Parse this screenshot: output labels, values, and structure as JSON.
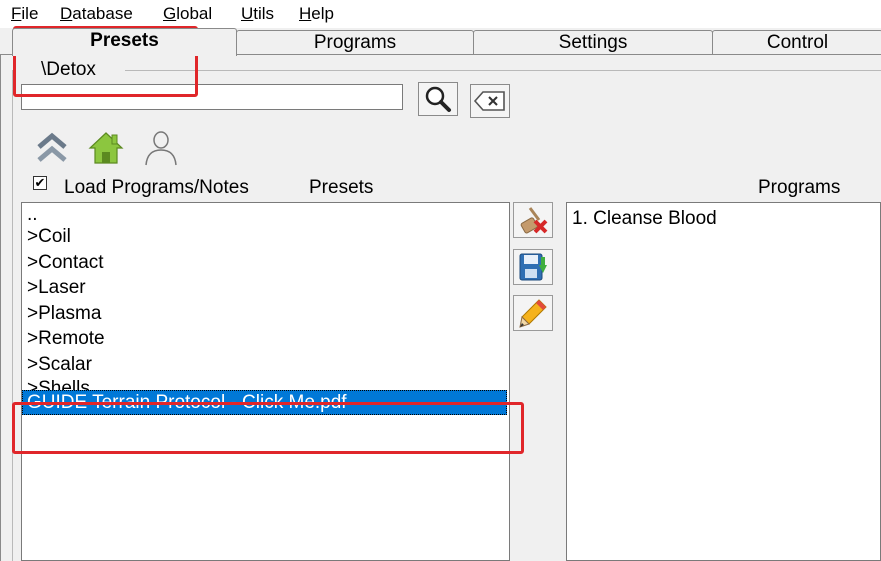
{
  "menu": {
    "items": [
      {
        "mnemonic": "F",
        "rest": "ile"
      },
      {
        "mnemonic": "D",
        "rest": "atabase"
      },
      {
        "mnemonic": "G",
        "rest": "lobal"
      },
      {
        "mnemonic": "U",
        "rest": "tils"
      },
      {
        "mnemonic": "H",
        "rest": "elp"
      }
    ]
  },
  "tabs": [
    "Presets",
    "Programs",
    "Settings",
    "Control"
  ],
  "active_tab": "Presets",
  "path": "\\Detox",
  "search": {
    "value": "",
    "placeholder": ""
  },
  "load_notes": {
    "label": "Load Programs/Notes",
    "checked": true
  },
  "presets_label": "Presets",
  "programs_label": "Programs",
  "presets_list": [
    "..",
    ">Coil",
    ">Contact",
    ">Laser",
    ">Plasma",
    ">Remote",
    ">Scalar",
    ">Shells",
    "GUIDE Terrain Protocol - Click Me.pdf"
  ],
  "selected_preset": "GUIDE Terrain Protocol - Click Me.pdf",
  "programs_list": [
    "1. Cleanse Blood"
  ],
  "icons": {
    "search": "magnifier-icon",
    "clear": "clear-backspace-icon",
    "up": "double-chevron-up-icon",
    "home": "home-icon",
    "user": "user-icon",
    "delete": "eraser-delete-icon",
    "save": "save-disk-icon",
    "edit": "pencil-icon"
  },
  "highlight_color": "#e0262a",
  "selection_color": "#0078d7"
}
